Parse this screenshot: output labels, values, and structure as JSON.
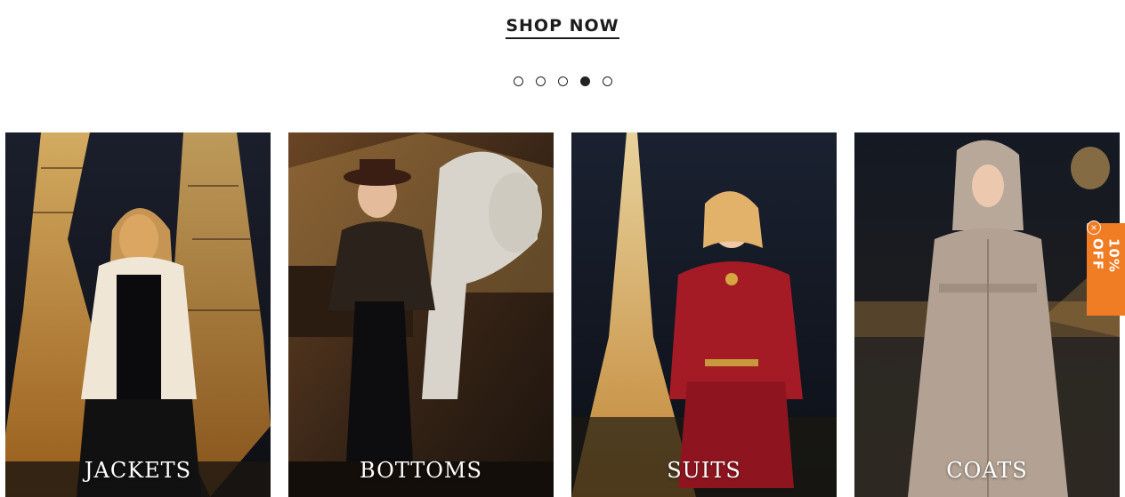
{
  "hero": {
    "shop_now_label": "SHOP NOW"
  },
  "carousel": {
    "slide_count": 5,
    "active_index": 4
  },
  "categories": [
    {
      "label": "JACKETS"
    },
    {
      "label": "BOTTOMS"
    },
    {
      "label": "SUITS"
    },
    {
      "label": "COATS"
    }
  ],
  "promo": {
    "label": "10% OFF",
    "close_symbol": "×",
    "color": "#f07c24"
  }
}
